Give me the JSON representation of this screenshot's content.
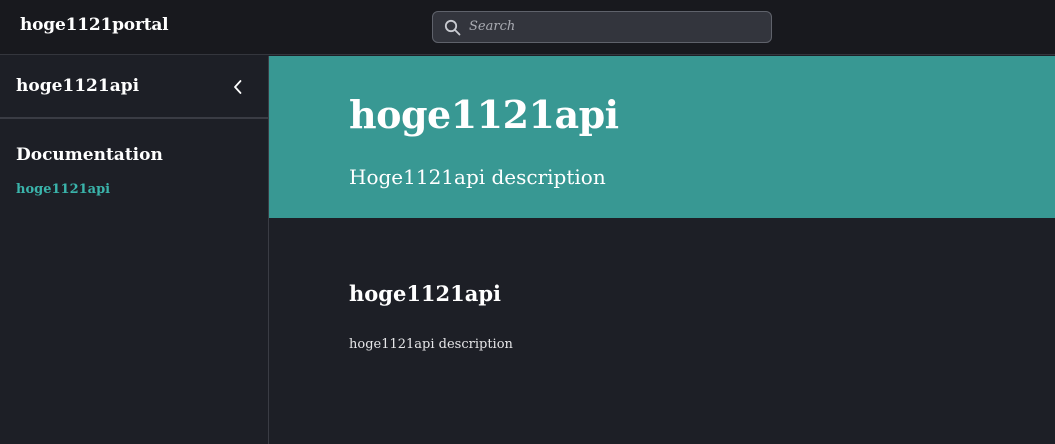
{
  "app": {
    "brand": "hoge1121portal"
  },
  "search": {
    "placeholder": "Search",
    "icon": "search-icon"
  },
  "sidebar": {
    "title": "hoge1121api",
    "collapse_icon": "chevron-left-icon",
    "section_heading": "Documentation",
    "items": [
      {
        "label": "hoge1121api",
        "active": true
      }
    ]
  },
  "hero": {
    "title": "hoge1121api",
    "subtitle": "Hoge1121api description"
  },
  "content": {
    "title": "hoge1121api",
    "description": "hoge1121api description"
  },
  "colors": {
    "topbar_bg": "#18191e",
    "page_bg": "#1d1f26",
    "hero_bg": "#389893",
    "accent_link": "#3ab3aa"
  }
}
